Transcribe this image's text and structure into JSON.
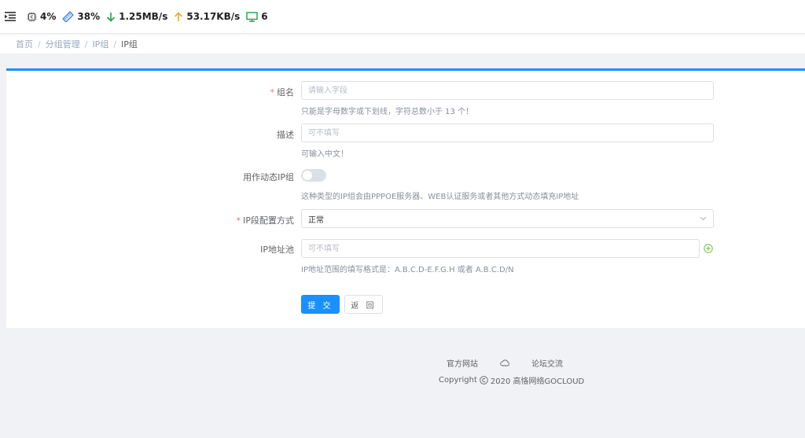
{
  "topbar": {
    "cpu": "4%",
    "memory": "38%",
    "download": "1.25MB/s",
    "upload": "53.17KB/s",
    "devices": "6"
  },
  "breadcrumb": [
    "首页",
    "分组管理",
    "IP组",
    "IP组"
  ],
  "form": {
    "group_name": {
      "label": "组名",
      "required": true,
      "placeholder": "请输入字段",
      "hint": "只能是字母数字或下划线，字符总数小于 13 个！"
    },
    "description": {
      "label": "描述",
      "placeholder": "可不填写",
      "hint": "可输入中文！"
    },
    "dynamic_group": {
      "label": "用作动态IP组",
      "checked": false,
      "hint": "这种类型的IP组会由PPPOE服务器、WEB认证服务或者其他方式动态填充IP地址"
    },
    "ip_config_mode": {
      "label": "IP段配置方式",
      "required": true,
      "value": "正常"
    },
    "ip_pool": {
      "label": "IP地址池",
      "placeholder": "可不填写",
      "hint": "IP地址范围的填写格式是：A.B.C.D-E.F.G.H 或者 A.B.C.D/N"
    },
    "submit_label": "提 交",
    "back_label": "返 回"
  },
  "footer": {
    "official_site": "官方网站",
    "forum": "论坛交流",
    "copyright": "Copyright",
    "copyright_rest": "2020 高恪网络GOCLOUD"
  },
  "colors": {
    "accent": "#1890ff",
    "required": "#f56c6c",
    "download": "#1aa34a",
    "upload": "#f5a623",
    "add": "#67c23a"
  }
}
